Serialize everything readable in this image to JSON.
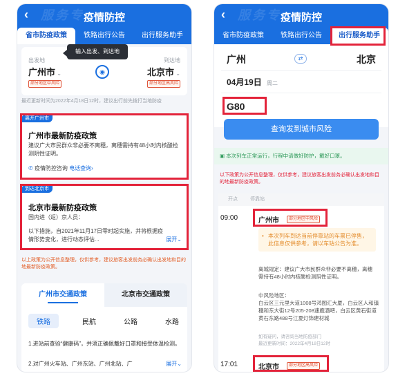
{
  "header": {
    "title": "疫情防控",
    "watermark": "服务专"
  },
  "tabs": [
    "省市防疫政策",
    "铁路出行公告",
    "出行服务助手"
  ],
  "left": {
    "route": {
      "from_label": "出发地",
      "from_city": "广州市",
      "from_tag": "部分地区中风险",
      "to_label": "到达地",
      "to_city": "北京市",
      "to_tag": "部分地区高风险",
      "tooltip": "输入出发、到达地"
    },
    "update_note": "最近更新时间为2022年4月18日12时，建议出行前先拨打当地防疫",
    "leave_card": {
      "ribbon": "离开广州市",
      "title": "广州市最新防疫政策",
      "body": "建议广大市民群众非必要不离穗，离穗需持有48小时内核酸检测阴性证明。",
      "consult": "疫情防控咨询",
      "phone_link": "电话查询›"
    },
    "arrive_card": {
      "ribbon": "到达北京市",
      "title": "北京市最新防疫政策",
      "subtitle": "国内进（返）京人员：",
      "body": "以下措施，自2021年11月17日零时起实施，并将根据疫情形势变化，进行动态评估...",
      "expand": "展开⌄"
    },
    "disclaimer": "以上政策为公开信息整理，仅供参考，建议旅客出发前务必确认出发地和目的地最新防疫政策。",
    "traffic_tabs": [
      "广州市交通政策",
      "北京市交通政策"
    ],
    "mode_tabs": [
      "铁路",
      "民航",
      "公路",
      "水路"
    ],
    "item1": "1.进站前查验“健康码”，并须正确佩戴好口罩和接受体温检测。",
    "item2": "2.对广州火车站、广州东站、广州北站、广",
    "item2_expand": "展开⌄"
  },
  "right": {
    "from_city": "广州",
    "to_city": "北京",
    "date": "04月19日",
    "weekday": "周二",
    "train": "G80",
    "query_button": "查询发到城市风险",
    "notice": "本次列车正常运行，行程中请做好防护，戴好口罩。",
    "disclaimer": "以下政策为公开信息整理，仅供参考，建议旅客出发前务必确认出发地和目的地最新防疫政策。",
    "col_depart": "开点",
    "col_station": "停靠站",
    "stop1": {
      "time": "09:00",
      "city": "广州市",
      "tag": "部分地区中风险"
    },
    "warning": "本次列车到达当前停靠站的车票已停售，此信息仅供参考，请以车站公告为准。",
    "policy": "离城规定：建议广大市民群众非必要不离穗，离穗需持有48小时内核酸检测阴性证明。",
    "mid_risk_label": "中风险地区：",
    "mid_risk_text": "白云区三元里大道1008号鸿图汇大厦，白云区人和镇穗和东大街12号205-208速鹿酒吧，白云区黄石街道黄石东路488号江夏灯饰建材城",
    "faq": "如有疑问，请咨询当地防疫部门",
    "update": "最近更新时间：2022年4月18日12时",
    "stop2": {
      "time": "17:01",
      "city": "北京市",
      "tag": "部分地区高风险"
    }
  }
}
